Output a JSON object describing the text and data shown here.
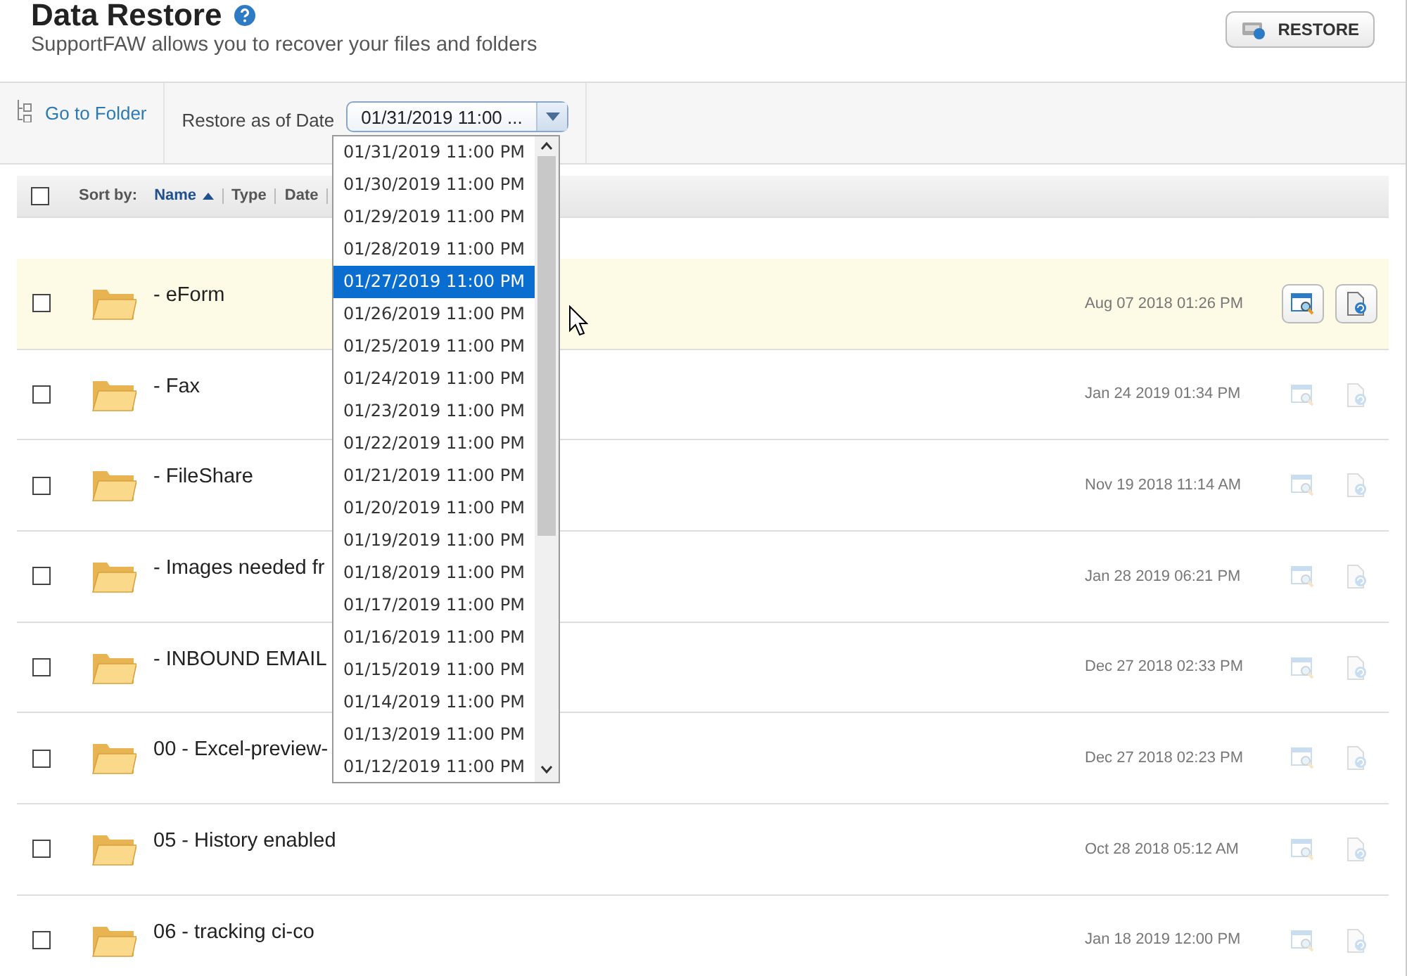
{
  "header": {
    "title": "Data Restore",
    "subtitle": "SupportFAW allows you to recover your files and folders",
    "restore_button": "RESTORE"
  },
  "toolbar": {
    "go_to_folder": "Go to Folder",
    "date_label": "Restore as of Date",
    "date_value": "01/31/2019 11:00 ..."
  },
  "sort_bar": {
    "select_all_checked": false,
    "label": "Sort by:",
    "columns": [
      {
        "label": "Name",
        "selected": true
      },
      {
        "label": "Type",
        "selected": false
      },
      {
        "label": "Date",
        "selected": false
      }
    ]
  },
  "rows": [
    {
      "name": "- eForm",
      "date": "Aug 07 2018 01:26 PM",
      "highlighted": true,
      "checked": false
    },
    {
      "name": "- Fax",
      "date": "Jan 24 2019 01:34 PM",
      "highlighted": false,
      "checked": false
    },
    {
      "name": "- FileShare",
      "date": "Nov 19 2018 11:14 AM",
      "highlighted": false,
      "checked": false
    },
    {
      "name": "- Images needed fr",
      "date": "Jan 28 2019 06:21 PM",
      "highlighted": false,
      "checked": false
    },
    {
      "name": "- INBOUND EMAIL",
      "date": "Dec 27 2018 02:33 PM",
      "highlighted": false,
      "checked": false
    },
    {
      "name": "00 - Excel-preview-",
      "date": "Dec 27 2018 02:23 PM",
      "highlighted": false,
      "checked": false
    },
    {
      "name": "05 - History enabled",
      "date": "Oct 28 2018 05:12 AM",
      "highlighted": false,
      "checked": false
    },
    {
      "name": "06 - tracking ci-co",
      "date": "Jan 18 2019 12:00 PM",
      "highlighted": false,
      "checked": false
    }
  ],
  "date_dropdown": {
    "options": [
      {
        "label": "01/31/2019 11:00 PM",
        "selected": false
      },
      {
        "label": "01/30/2019 11:00 PM",
        "selected": false
      },
      {
        "label": "01/29/2019 11:00 PM",
        "selected": false
      },
      {
        "label": "01/28/2019 11:00 PM",
        "selected": false
      },
      {
        "label": "01/27/2019 11:00 PM",
        "selected": true
      },
      {
        "label": "01/26/2019 11:00 PM",
        "selected": false
      },
      {
        "label": "01/25/2019 11:00 PM",
        "selected": false
      },
      {
        "label": "01/24/2019 11:00 PM",
        "selected": false
      },
      {
        "label": "01/23/2019 11:00 PM",
        "selected": false
      },
      {
        "label": "01/22/2019 11:00 PM",
        "selected": false
      },
      {
        "label": "01/21/2019 11:00 PM",
        "selected": false
      },
      {
        "label": "01/20/2019 11:00 PM",
        "selected": false
      },
      {
        "label": "01/19/2019 11:00 PM",
        "selected": false
      },
      {
        "label": "01/18/2019 11:00 PM",
        "selected": false
      },
      {
        "label": "01/17/2019 11:00 PM",
        "selected": false
      },
      {
        "label": "01/16/2019 11:00 PM",
        "selected": false
      },
      {
        "label": "01/15/2019 11:00 PM",
        "selected": false
      },
      {
        "label": "01/14/2019 11:00 PM",
        "selected": false
      },
      {
        "label": "01/13/2019 11:00 PM",
        "selected": false
      },
      {
        "label": "01/12/2019 11:00 PM",
        "selected": false
      }
    ]
  }
}
